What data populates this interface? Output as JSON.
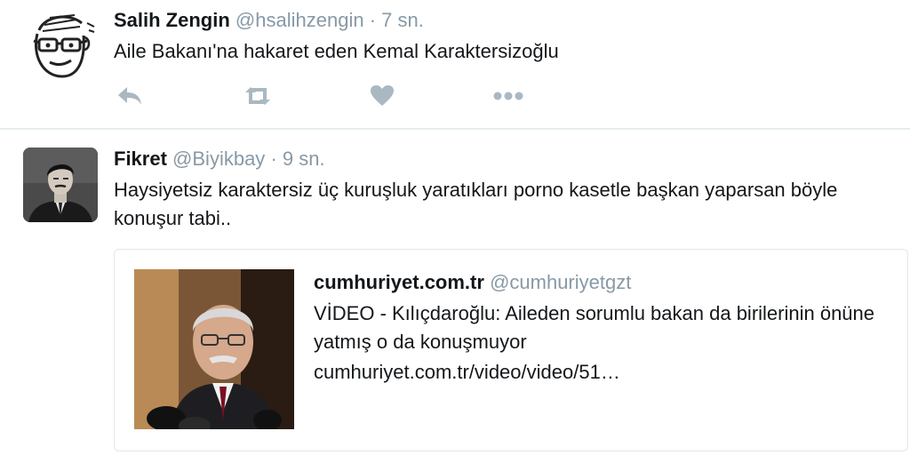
{
  "tweets": [
    {
      "name": "Salih Zengin",
      "handle": "@hsalihzengin",
      "separator": "·",
      "time": "7 sn.",
      "text": "Aile Bakanı'na hakaret eden Kemal Karaktersizoğlu",
      "actions": [
        "reply-icon",
        "retweet-icon",
        "like-icon",
        "more-icon"
      ]
    },
    {
      "name": "Fikret",
      "handle": "@Biyikbay",
      "separator": "·",
      "time": "9 sn.",
      "text": "Haysiyetsiz karaktersiz üç kuruşluk yaratıkları porno kasetle başkan yaparsan böyle konuşur tabi..",
      "card": {
        "site": "cumhuriyet.com.tr",
        "handle": "@cumhuriyetgzt",
        "title": "VİDEO - Kılıçdaroğlu: Aileden sorumlu bakan da birilerinin önüne yatmış o da konuşmuyor",
        "url": "cumhuriyet.com.tr/video/video/51…"
      }
    }
  ],
  "colors": {
    "icon": "#aab8c2",
    "meta": "#8899a6",
    "divider": "#e6ecf0",
    "text": "#14171a"
  }
}
